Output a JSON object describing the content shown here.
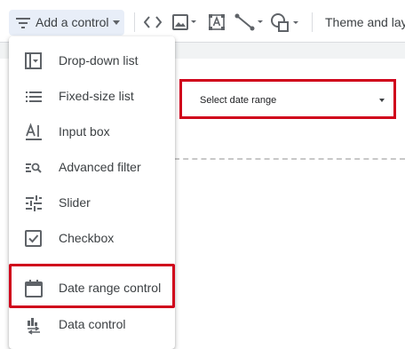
{
  "toolbar": {
    "add_control_label": "Add a control",
    "icons": [
      "filter-list-icon",
      "caret-down-icon",
      "code-brackets-icon",
      "image-icon",
      "text-box-icon",
      "line-icon",
      "shape-icon"
    ],
    "theme_label": "Theme and lay"
  },
  "canvas": {
    "date_control": {
      "label": "Select date range"
    }
  },
  "menu": {
    "items": [
      {
        "label": "Drop-down list",
        "icon": "dropdown-list-icon"
      },
      {
        "label": "Fixed-size list",
        "icon": "fixed-list-icon"
      },
      {
        "label": "Input box",
        "icon": "input-box-icon"
      },
      {
        "label": "Advanced filter",
        "icon": "advanced-filter-icon"
      },
      {
        "label": "Slider",
        "icon": "slider-icon"
      },
      {
        "label": "Checkbox",
        "icon": "checkbox-icon"
      },
      {
        "label": "Date range control",
        "icon": "calendar-icon"
      },
      {
        "label": "Data control",
        "icon": "data-control-icon"
      }
    ],
    "highlighted_item": "Date range control"
  },
  "colors": {
    "highlight_border": "#d0021b",
    "button_bg": "#e8eef8",
    "icon": "#5f6368",
    "text": "#3c4043"
  }
}
